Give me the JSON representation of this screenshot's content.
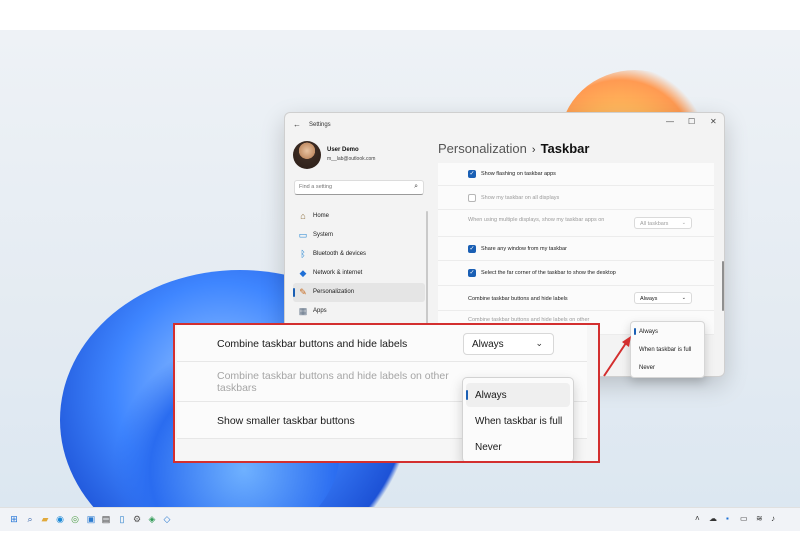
{
  "window": {
    "title": "Settings",
    "back_glyph": "←",
    "minimize_glyph": "—",
    "maximize_glyph": "☐",
    "close_glyph": "✕"
  },
  "profile": {
    "name": "User Demo",
    "email": "m__lab@outlook.com"
  },
  "search": {
    "placeholder": "Find a setting",
    "icon": "search-icon"
  },
  "nav": {
    "items": [
      {
        "label": "Home",
        "icon": "home-icon",
        "glyph": "⌂"
      },
      {
        "label": "System",
        "icon": "system-icon",
        "glyph": "▭"
      },
      {
        "label": "Bluetooth & devices",
        "icon": "bluetooth-icon",
        "glyph": "ᛒ"
      },
      {
        "label": "Network & internet",
        "icon": "network-icon",
        "glyph": "◆"
      },
      {
        "label": "Personalization",
        "icon": "brush-icon",
        "glyph": "✎",
        "active": true
      },
      {
        "label": "Apps",
        "icon": "apps-icon",
        "glyph": "▦"
      }
    ]
  },
  "breadcrumb": {
    "parent": "Personalization",
    "separator": "›",
    "current": "Taskbar"
  },
  "settings": {
    "flashing": "Show flashing on taskbar apps",
    "all_displays": "Show my taskbar on all displays",
    "multi_display": "When using multiple displays, show my taskbar apps on",
    "multi_display_value": "All taskbars",
    "share_window": "Share any window from my taskbar",
    "far_corner": "Select the far corner of the taskbar to show the desktop",
    "combine": "Combine taskbar buttons and hide labels",
    "combine_value": "Always",
    "combine_other": "Combine taskbar buttons and hide labels on other"
  },
  "dropdown": {
    "options": [
      "Always",
      "When taskbar is full",
      "Never"
    ],
    "selected": "Always"
  },
  "callout": {
    "combine": "Combine taskbar buttons and hide labels",
    "combine_value": "Always",
    "combine_other": "Combine taskbar buttons and hide labels on other taskbars",
    "smaller": "Show smaller taskbar buttons",
    "options": [
      "Always",
      "When taskbar is full",
      "Never"
    ]
  },
  "colors": {
    "accent": "#1a5fb4",
    "highlight_border": "#d32f2f",
    "arrow": "#d32f2f"
  },
  "taskbar": {
    "icons": [
      "start-icon",
      "search-icon",
      "file-explorer-icon",
      "edge-icon",
      "chrome-icon",
      "photos-icon",
      "terminal-icon",
      "notepad-icon",
      "settings-icon",
      "app-icon",
      "app-icon"
    ],
    "tray": [
      "chevron-up-icon",
      "cloud-icon",
      "store-icon",
      "display-icon",
      "wifi-icon",
      "volume-icon"
    ]
  }
}
